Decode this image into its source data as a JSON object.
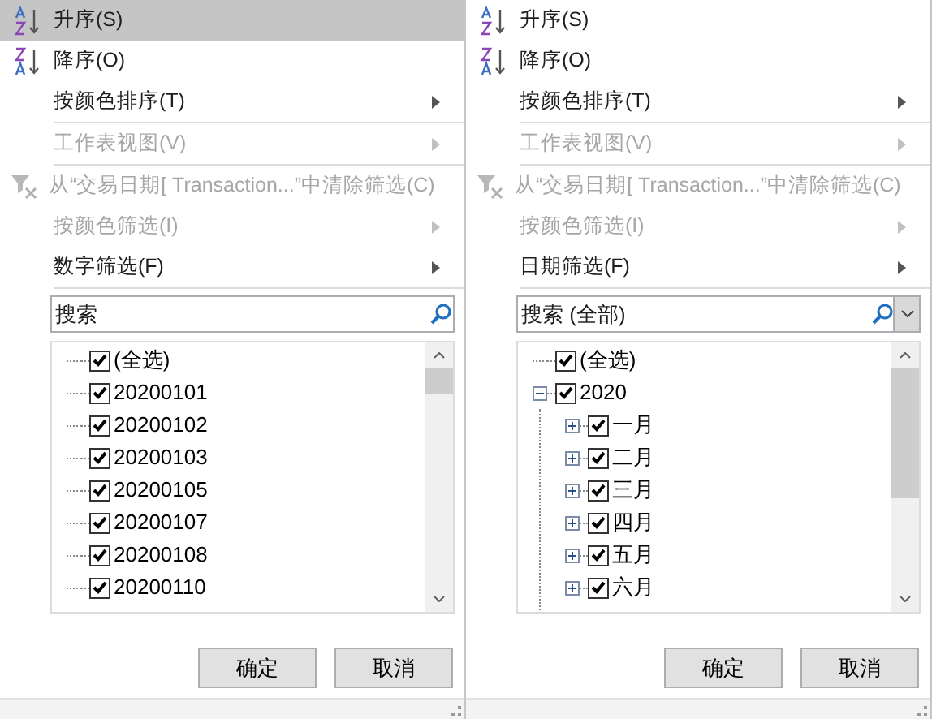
{
  "panels": [
    {
      "menu": [
        {
          "kind": "sort_asc",
          "label": "升序(S)",
          "selected": true,
          "disabled": false,
          "submenu": false,
          "separator_after": false
        },
        {
          "kind": "sort_desc",
          "label": "降序(O)",
          "selected": false,
          "disabled": false,
          "submenu": false,
          "separator_after": false
        },
        {
          "kind": "plain",
          "label": "按颜色排序(T)",
          "selected": false,
          "disabled": false,
          "submenu": true,
          "separator_after": true
        },
        {
          "kind": "plain",
          "label": "工作表视图(V)",
          "selected": false,
          "disabled": true,
          "submenu": true,
          "separator_after": true
        },
        {
          "kind": "clear_filter",
          "label": "从“交易日期[ Transaction...”中清除筛选(C)",
          "selected": false,
          "disabled": true,
          "submenu": false,
          "separator_after": false
        },
        {
          "kind": "plain",
          "label": "按颜色筛选(I)",
          "selected": false,
          "disabled": true,
          "submenu": true,
          "separator_after": false
        },
        {
          "kind": "plain",
          "label": "数字筛选(F)",
          "selected": false,
          "disabled": false,
          "submenu": true,
          "separator_after": true
        }
      ],
      "search": {
        "placeholder": "搜索",
        "dropdown": false
      },
      "list": [
        {
          "label": "(全选)",
          "checked": true
        },
        {
          "label": "20200101",
          "checked": true
        },
        {
          "label": "20200102",
          "checked": true
        },
        {
          "label": "20200103",
          "checked": true
        },
        {
          "label": "20200105",
          "checked": true
        },
        {
          "label": "20200107",
          "checked": true
        },
        {
          "label": "20200108",
          "checked": true
        },
        {
          "label": "20200110",
          "checked": true
        }
      ],
      "buttons": [
        "确定",
        "取消"
      ]
    },
    {
      "menu": [
        {
          "kind": "sort_asc",
          "label": "升序(S)",
          "selected": false,
          "disabled": false,
          "submenu": false,
          "separator_after": false
        },
        {
          "kind": "sort_desc",
          "label": "降序(O)",
          "selected": false,
          "disabled": false,
          "submenu": false,
          "separator_after": false
        },
        {
          "kind": "plain",
          "label": "按颜色排序(T)",
          "selected": false,
          "disabled": false,
          "submenu": true,
          "separator_after": true
        },
        {
          "kind": "plain",
          "label": "工作表视图(V)",
          "selected": false,
          "disabled": true,
          "submenu": true,
          "separator_after": true
        },
        {
          "kind": "clear_filter",
          "label": "从“交易日期[ Transaction...”中清除筛选(C)",
          "selected": false,
          "disabled": true,
          "submenu": false,
          "separator_after": false
        },
        {
          "kind": "plain",
          "label": "按颜色筛选(I)",
          "selected": false,
          "disabled": true,
          "submenu": true,
          "separator_after": false
        },
        {
          "kind": "plain",
          "label": "日期筛选(F)",
          "selected": false,
          "disabled": false,
          "submenu": true,
          "separator_after": true
        }
      ],
      "search": {
        "placeholder": "搜索 (全部)",
        "dropdown": true
      },
      "list": [
        {
          "label": "(全选)",
          "checked": true
        },
        {
          "label": "2020",
          "checked": true,
          "expanded": true,
          "children": [
            {
              "label": "一月",
              "checked": true,
              "expanded": false
            },
            {
              "label": "二月",
              "checked": true,
              "expanded": false
            },
            {
              "label": "三月",
              "checked": true,
              "expanded": false
            },
            {
              "label": "四月",
              "checked": true,
              "expanded": false
            },
            {
              "label": "五月",
              "checked": true,
              "expanded": false
            },
            {
              "label": "六月",
              "checked": true,
              "expanded": false
            }
          ]
        }
      ],
      "buttons": [
        "确定",
        "取消"
      ]
    }
  ]
}
